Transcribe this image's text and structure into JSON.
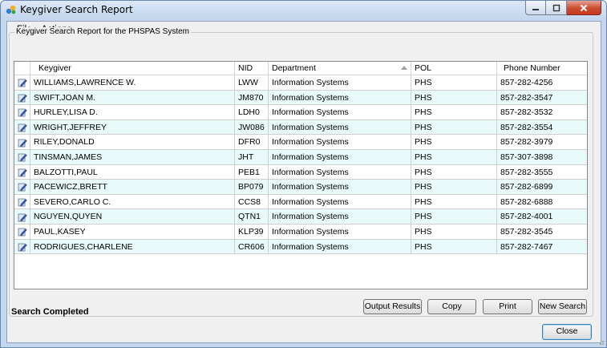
{
  "window": {
    "title": "Keygiver Search Report"
  },
  "menu": {
    "items": [
      "File",
      "Actions"
    ]
  },
  "group": {
    "title": "Keygiver Search Report for the PHSPAS System"
  },
  "grid": {
    "columns": [
      "",
      "Keygiver",
      "NID",
      "Department",
      "POL",
      "Phone Number"
    ],
    "sort_column": "Department",
    "row_icon": "edit-pencil-icon",
    "rows": [
      [
        "WILLIAMS,LAWRENCE W.",
        "LWW",
        "Information Systems",
        "PHS",
        "857-282-4256"
      ],
      [
        "SWIFT,JOAN M.",
        "JM870",
        "Information Systems",
        "PHS",
        "857-282-3547"
      ],
      [
        "HURLEY,LISA D.",
        "LDH0",
        "Information Systems",
        "PHS",
        "857-282-3532"
      ],
      [
        "WRIGHT,JEFFREY",
        "JW086",
        "Information Systems",
        "PHS",
        "857-282-3554"
      ],
      [
        "RILEY,DONALD",
        "DFR0",
        "Information Systems",
        "PHS",
        "857-282-3979"
      ],
      [
        "TINSMAN,JAMES",
        "JHT",
        "Information Systems",
        "PHS",
        "857-307-3898"
      ],
      [
        "BALZOTTI,PAUL",
        "PEB1",
        "Information Systems",
        "PHS",
        "857-282-3555"
      ],
      [
        "PACEWICZ,BRETT",
        "BP079",
        "Information Systems",
        "PHS",
        "857-282-6899"
      ],
      [
        "SEVERO,CARLO C.",
        "CCS8",
        "Information Systems",
        "PHS",
        "857-282-6888"
      ],
      [
        "NGUYEN,QUYEN",
        "QTN1",
        "Information Systems",
        "PHS",
        "857-282-4001"
      ],
      [
        "PAUL,KASEY",
        "KLP39",
        "Information Systems",
        "PHS",
        "857-282-3545"
      ],
      [
        "RODRIGUES,CHARLENE",
        "CR606",
        "Information Systems",
        "PHS",
        "857-282-7467"
      ]
    ]
  },
  "buttons": {
    "output_results": "Output Results",
    "copy": "Copy",
    "print": "Print",
    "new_search": "New Search",
    "close": "Close"
  },
  "status": {
    "text": "Search Completed"
  },
  "colors": {
    "alt_row": "#e8fbfa",
    "title_bar": "#c5d7ee",
    "close_button": "#c94a2f"
  }
}
